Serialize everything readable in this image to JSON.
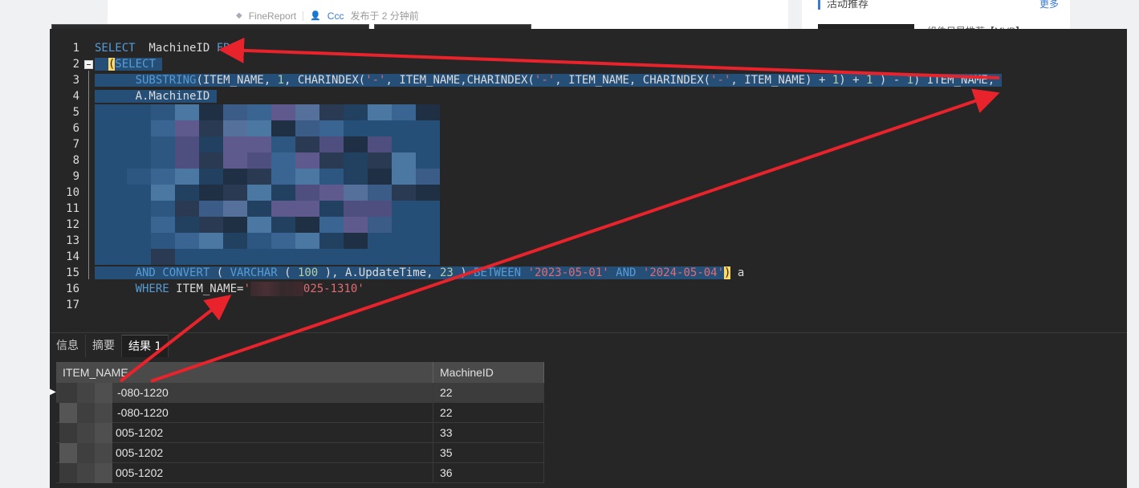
{
  "background_page": {
    "tag": "FineReport",
    "author": "Ccc",
    "posted": "发布于 2 分钟前",
    "side_title": "活动推荐",
    "side_more": "更多",
    "side_text": "组件目导推荐【MVP】"
  },
  "editor": {
    "line_numbers": [
      "1",
      "2",
      "3",
      "4",
      "5",
      "6",
      "7",
      "8",
      "9",
      "10",
      "11",
      "12",
      "13",
      "14",
      "15",
      "16",
      "17"
    ],
    "line1": {
      "kw": "SELECT",
      "col": "  MachineID ",
      "from": "FROM"
    },
    "line2": {
      "paren": "(",
      "kw": "SELECT"
    },
    "line3": {
      "fn": "SUBSTRING",
      "a": "(ITEM_NAME, ",
      "n1": "1",
      "b": ", CHARINDEX(",
      "s1": "'-'",
      "c": ", ITEM_NAME,CHARINDEX(",
      "s2": "'-'",
      "d": ", ITEM_NAME, CHARINDEX(",
      "s3": "'-'",
      "e": ", ITEM_NAME) + ",
      "n2": "1",
      "f": ") + ",
      "n3": "1",
      "g": " ) - ",
      "n4": "1",
      "h": ") ITEM_NAME,"
    },
    "line4": "A.MachineID",
    "line15": {
      "and": "AND",
      "convert": "CONVERT",
      "a": " ( ",
      "varchar": "VARCHAR",
      "b": " ( ",
      "n100": "100",
      "c": " ), A.UpdateTime, ",
      "n23": "23",
      "d": " ) ",
      "between": "BETWEEN",
      "s1": "'2023-05-01'",
      "and2": "AND",
      "s2": "'2024-05-04'",
      "close": ")",
      "alias": " a"
    },
    "line16": {
      "where": "WHERE",
      "mid": " ITEM_NAME=",
      "s_start": "'",
      "s_end": "025-1310'"
    }
  },
  "panel": {
    "tabs": [
      "信息",
      "摘要",
      "结果 1"
    ],
    "active_tab": "结果 1",
    "columns": [
      "ITEM_NAME",
      "MachineID"
    ],
    "rows": [
      {
        "item": "-080-1220",
        "machine": "22"
      },
      {
        "item": "-080-1220",
        "machine": "22"
      },
      {
        "item": "005-1202",
        "machine": "33"
      },
      {
        "item": "005-1202",
        "machine": "35"
      },
      {
        "item": "005-1202",
        "machine": "36"
      }
    ]
  },
  "colors": {
    "editor_bg": "#262626",
    "selection": "#264f78",
    "keyword": "#569cd6",
    "string": "#e06c75",
    "number": "#b5cea8",
    "arrow": "#e8232b"
  }
}
